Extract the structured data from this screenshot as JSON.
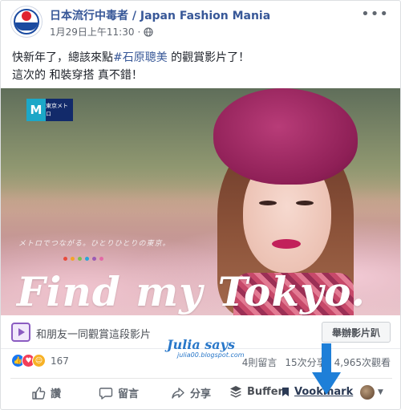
{
  "header": {
    "page_name": "日本流行中毒者 / Japan Fashion Mania",
    "timestamp": "1月29日上午11:30",
    "more_icon": "more-dots-icon"
  },
  "post": {
    "line1_pre": "快新年了，總該來點",
    "hashtag": "#石原聰美",
    "line1_post": " 的觀賞影片了！",
    "line2": "這次的 和裝穿搭 真不錯！"
  },
  "video": {
    "badge_left": "M",
    "badge_right": "東京メトロ",
    "tagline": "メトロでつながる。ひとりひとりの東京。",
    "title": "Find my Tokyo."
  },
  "watch_party": {
    "text": "和朋友一同觀賞這段影片",
    "button": "舉辦影片趴"
  },
  "watermark": {
    "title": "Julia says",
    "url": "julia00.blogspot.com"
  },
  "stats": {
    "reaction_count": "167",
    "comments": "4則留言",
    "shares": "15次分享",
    "views": "4,965次觀看"
  },
  "actions": {
    "like": "讚",
    "comment": "留言",
    "share": "分享",
    "buffer": "Buffer",
    "vookmark": "Vookmark"
  },
  "colors": {
    "link_blue": "#385898",
    "like_blue": "#1877f2",
    "arrow_blue": "#1e7fd8",
    "watermark_blue": "#2877c9"
  }
}
